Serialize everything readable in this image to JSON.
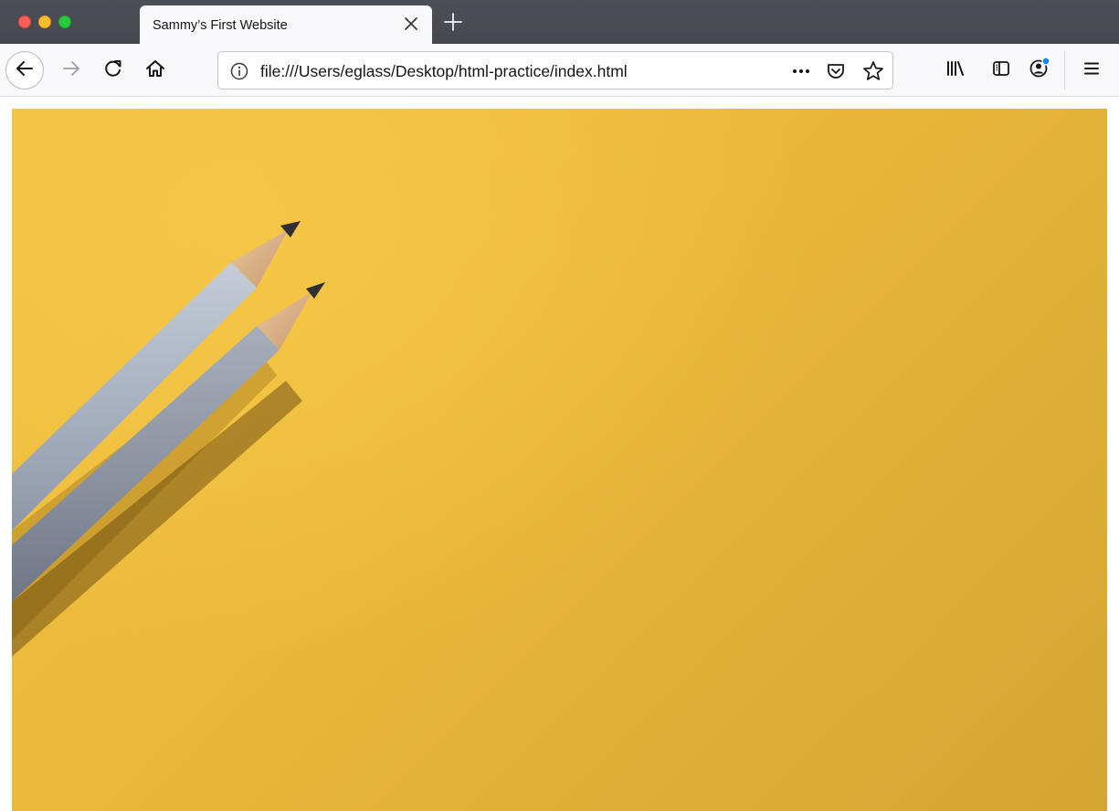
{
  "window": {
    "controls": [
      "close",
      "minimize",
      "zoom"
    ]
  },
  "tab": {
    "title": "Sammy’s First Website",
    "close_icon": "close-icon",
    "new_tab_icon": "plus-icon"
  },
  "nav": {
    "back_icon": "arrow-left-icon",
    "forward_icon": "arrow-right-icon",
    "reload_icon": "reload-icon",
    "home_icon": "home-icon"
  },
  "urlbar": {
    "info_icon": "info-icon",
    "url": "file:///Users/eglass/Desktop/html-practice/index.html",
    "page_actions_icon": "ellipsis-icon",
    "pocket_icon": "pocket-icon",
    "bookmark_icon": "star-icon"
  },
  "toolbar": {
    "library_icon": "library-icon",
    "sidebar_icon": "sidebar-icon",
    "account_icon": "account-icon",
    "account_badge_color": "#0a84ff",
    "menu_icon": "hamburger-menu-icon"
  },
  "page": {
    "image_subject": "two-pencils-on-yellow-paper",
    "background_color": "#ebb93a"
  }
}
